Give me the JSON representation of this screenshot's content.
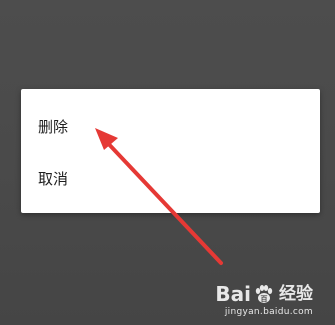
{
  "dialog": {
    "items": [
      {
        "label": "删除"
      },
      {
        "label": "取消"
      }
    ]
  },
  "annotation": {
    "arrow_color": "#e53935"
  },
  "watermark": {
    "brand_left": "Bai",
    "brand_right": "百",
    "product": "经验",
    "url": "jingyan.baidu.com"
  },
  "colors": {
    "backdrop": "#4a4a4a",
    "dialog_bg": "#ffffff",
    "text": "#1e1e1e"
  }
}
